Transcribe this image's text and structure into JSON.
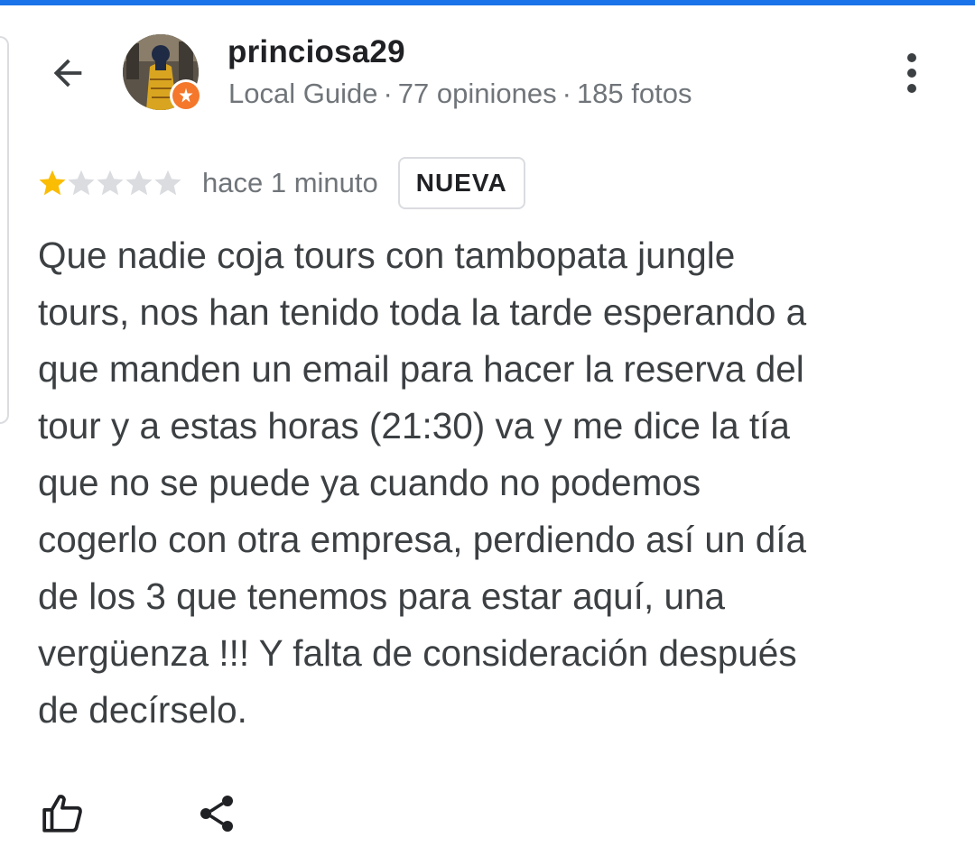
{
  "colors": {
    "accent": "#1a73e8",
    "star_filled": "#fbbc04",
    "star_empty": "#dadce0",
    "guide_badge": "#f4772b",
    "text_primary": "#202124",
    "text_secondary": "#70757a",
    "text_body": "#3c4043"
  },
  "header": {
    "back_icon": "arrow-back-icon",
    "user_name": "princiosa29",
    "user_role": "Local Guide",
    "separator": "·",
    "reviews_count": "77 opiniones",
    "photos_count": "185 fotos",
    "more_icon": "more-vert-icon"
  },
  "review": {
    "rating": 1,
    "max_rating": 5,
    "time_ago": "hace 1 minuto",
    "badge": "NUEVA",
    "text": "Que nadie coja tours con tambopata jungle\ntours, nos han tenido toda la tarde esperando a\nque manden un email para hacer la reserva del\ntour y a estas horas (21:30) va y me dice la tía\nque no se puede ya cuando no podemos\ncogerlo con otra empresa, perdiendo así un día\nde los 3 que tenemos para estar aquí, una\nvergüenza !!! Y falta de consideración después\nde decírselo."
  },
  "actions": {
    "like_icon": "thumb-up-icon",
    "share_icon": "share-icon"
  }
}
